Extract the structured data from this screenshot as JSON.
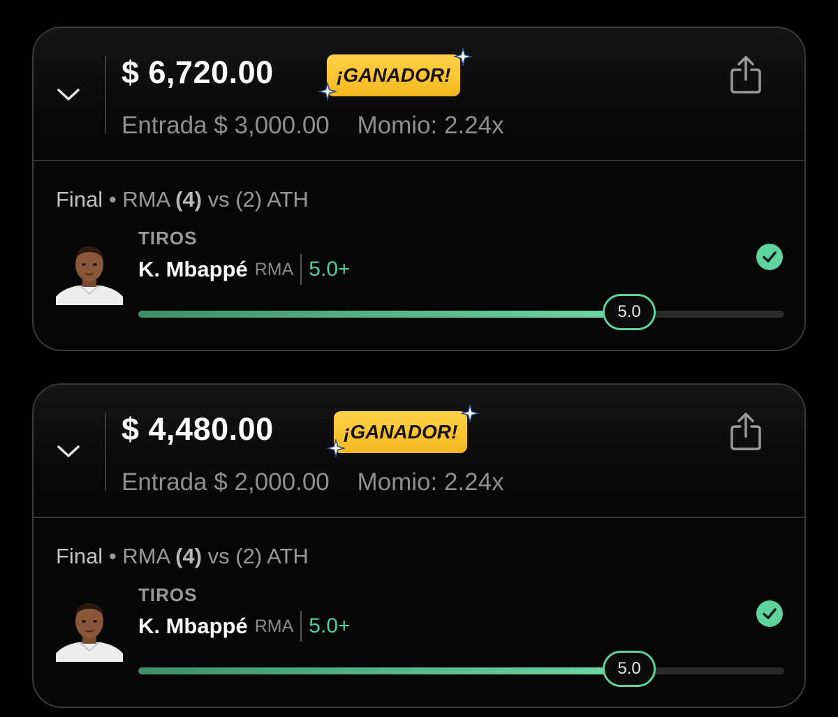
{
  "bets": [
    {
      "payout": "$ 6,720.00",
      "status_badge": "¡GANADOR!",
      "entry_label": "Entrada",
      "entry_amount": "$ 3,000.00",
      "odds": "Momio: 2.24x",
      "match": {
        "status": "Final",
        "separator": "•",
        "home_team": "RMA",
        "home_score": "(4)",
        "vs": "vs",
        "away_score": "(2)",
        "away_team": "ATH"
      },
      "market": "TIROS",
      "player": "K. Mbappé",
      "player_team": "RMA",
      "line": "5.0+",
      "progress_value": "5.0",
      "progress_fraction": 0.76,
      "result_icon": "check-circle-icon"
    },
    {
      "payout": "$ 4,480.00",
      "status_badge": "¡GANADOR!",
      "entry_label": "Entrada",
      "entry_amount": "$ 2,000.00",
      "odds": "Momio: 2.24x",
      "match": {
        "status": "Final",
        "separator": "•",
        "home_team": "RMA",
        "home_score": "(4)",
        "vs": "vs",
        "away_score": "(2)",
        "away_team": "ATH"
      },
      "market": "TIROS",
      "player": "K. Mbappé",
      "player_team": "RMA",
      "line": "5.0+",
      "progress_value": "5.0",
      "progress_fraction": 0.76,
      "result_icon": "check-circle-icon"
    }
  ],
  "icons": {
    "expand": "chevron-down-icon",
    "share": "share-icon",
    "sparkle": "sparkle-icon",
    "result": "check-circle-icon"
  },
  "colors": {
    "background": "#000000",
    "card_border": "#3b3b3b",
    "badge": "#f5bd24",
    "accent_green": "#5fd39d",
    "muted_text": "#8f8f8f"
  }
}
